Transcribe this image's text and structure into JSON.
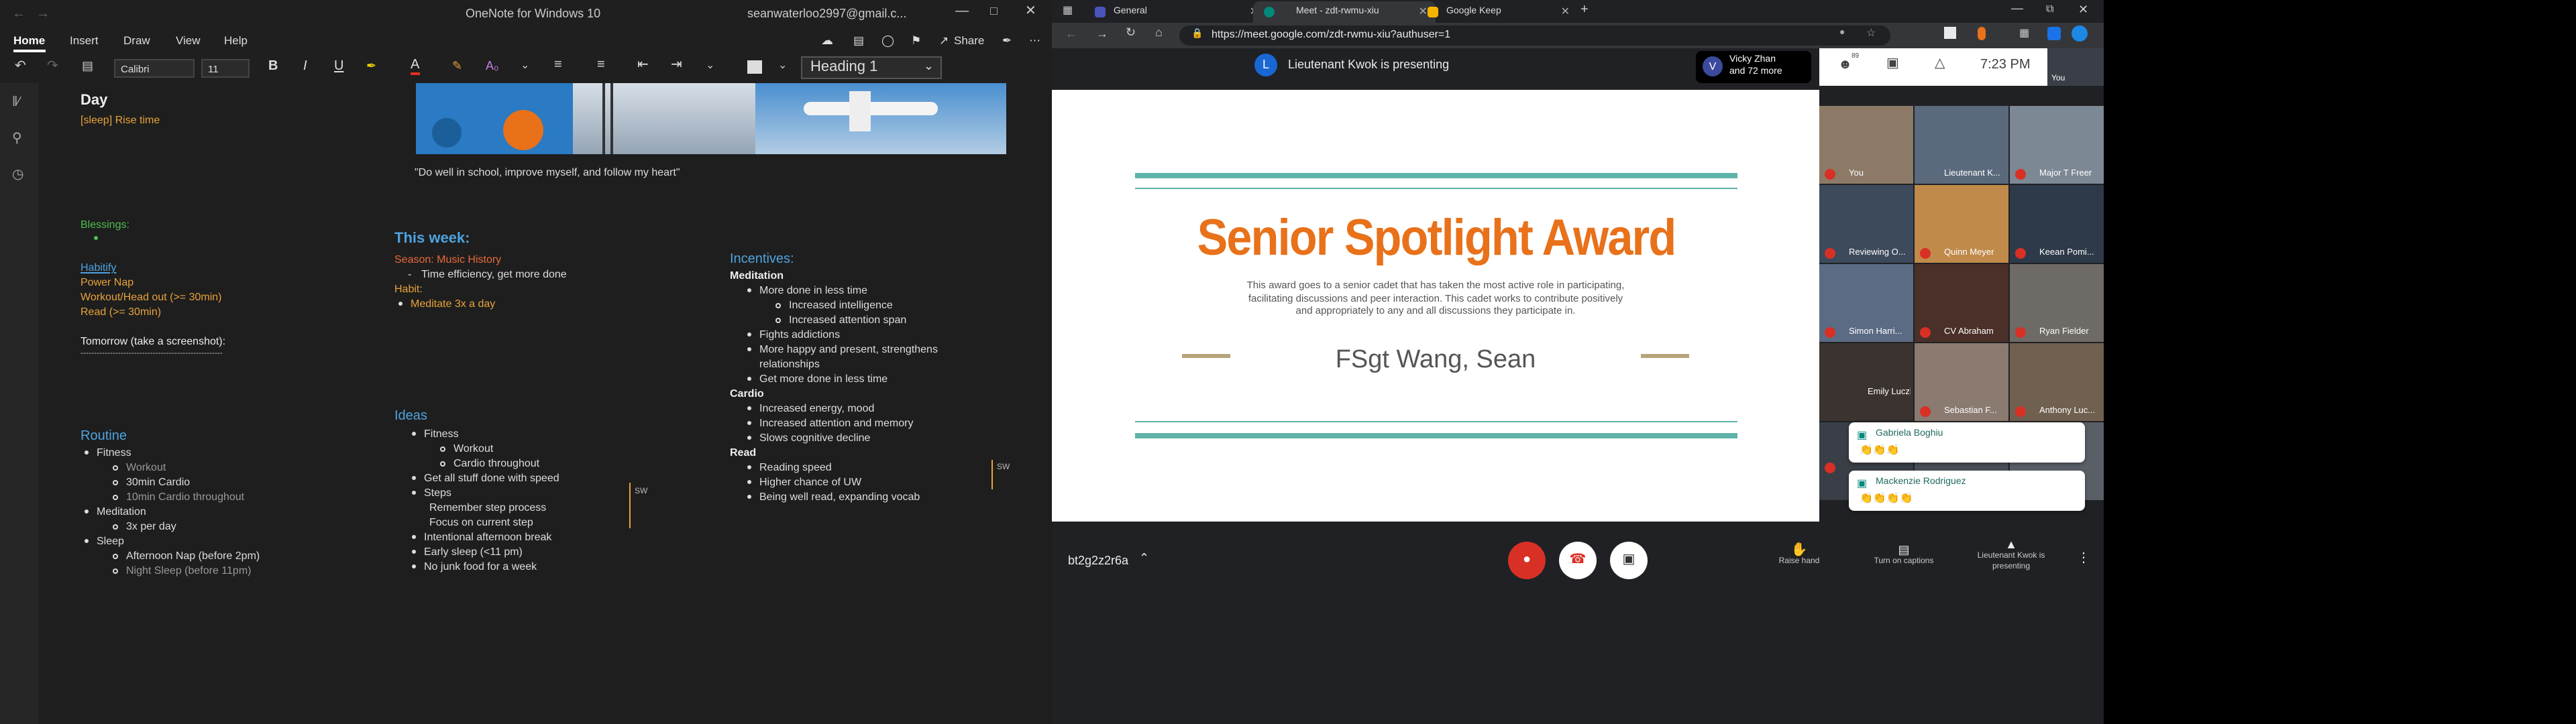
{
  "onenote": {
    "window_title": "OneNote for Windows 10",
    "account": "seanwaterloo2997@gmail.c...",
    "menu": [
      "Home",
      "Insert",
      "Draw",
      "View",
      "Help"
    ],
    "share": "Share",
    "font_name": "Calibri",
    "font_size": "11",
    "style": "Heading 1",
    "quote": "\"Do well in school, improve myself, and follow my heart\"",
    "day": {
      "title": "Day",
      "sleep": "[sleep] Rise time",
      "blessings": "Blessings:",
      "habitify": "Habitify",
      "power_nap": "Power Nap",
      "workout": "Workout/Head out (>= 30min)",
      "read": "Read (>= 30min)",
      "tomorrow": "Tomorrow (take a screenshot):",
      "rule": "-----------------------------------------------------"
    },
    "routine": {
      "title": "Routine",
      "fitness": "Fitness",
      "workout": "Workout",
      "cardio30": "30min Cardio",
      "cardio10": "10min Cardio throughout",
      "meditation": "Meditation",
      "per_day": "3x per day",
      "sleep": "Sleep",
      "nap": "Afternoon Nap (before 2pm)",
      "night": "Night Sleep (before 11pm)"
    },
    "week": {
      "title": "This week:",
      "season": "Season: Music History",
      "time": "Time efficiency, get more done",
      "habit": "Habit:",
      "meditate": "Meditate 3x a day"
    },
    "ideas": {
      "title": "Ideas",
      "fitness": "Fitness",
      "workout": "Workout",
      "cardio": "Cardio throughout",
      "stuff": "Get all stuff done with speed",
      "steps": "Steps",
      "remember": "Remember step process",
      "focus": "Focus on current step",
      "break": "Intentional afternoon break",
      "early": "Early sleep (<11 pm)",
      "junk": "No junk food for a week",
      "sw": "SW"
    },
    "incentives": {
      "title": "Incentives:",
      "meditation": "Meditation",
      "more_done": "More done in less time",
      "intel": "Increased intelligence",
      "attn": "Increased attention span",
      "fights": "Fights addictions",
      "happy": "More happy and present, strengthens relationships",
      "more_done2": "Get more done in less time",
      "cardio": "Cardio",
      "energy": "Increased energy, mood",
      "memory": "Increased attention and memory",
      "decline": "Slows cognitive decline",
      "read": "Read",
      "speed": "Reading speed",
      "uw": "Higher chance of UW",
      "vocab": "Being well read, expanding vocab",
      "sw": "SW"
    }
  },
  "browser": {
    "tabs": [
      "General",
      "Meet - zdt-rwmu-xiu",
      "Google Keep"
    ],
    "url": "https://meet.google.com/zdt-rwmu-xiu?authuser=1",
    "presenting": "Lieutenant Kwok is presenting",
    "presenter_initial": "L",
    "viewer_initial": "V",
    "viewers": "Vicky Zhan",
    "viewers_more": "and 72 more",
    "count": "89",
    "time": "7:23 PM",
    "you": "You",
    "meeting_code": "bt2g2z2r6a",
    "raise": "Raise hand",
    "captions": "Turn on captions",
    "presenting_ctl": "Lieutenant Kwok is presenting"
  },
  "slide": {
    "title": "Senior Spotlight Award",
    "desc": "This award goes to a senior cadet that has taken the most active role in participating, facilitating discussions and peer interaction. This cadet works to contribute positively and appropriately  to any and all discussions they participate in.",
    "name": "FSgt Wang, Sean"
  },
  "participants": [
    "You",
    "Lieutenant K...",
    "Major T Freer",
    "Reviewing O...",
    "Quinn Meyer",
    "Keean Pomi...",
    "Simon Harri...",
    "CV Abraham",
    "Ryan Fielder",
    "Emily Luczka",
    "Sebastian F...",
    "Anthony Luc..."
  ],
  "chat": [
    {
      "name": "Gabriela Boghiu",
      "msg": "👏👏👏"
    },
    {
      "name": "Mackenzie Rodriguez",
      "msg": "👏👏👏👏"
    }
  ],
  "colors": {
    "accent_orange": "#e8711a",
    "teal": "#5fb3a8",
    "gold": "#b8a47a",
    "green": "#4fbf4f",
    "blue": "#4ea3e0",
    "orange": "#e8a33a",
    "red": "#d93025"
  }
}
